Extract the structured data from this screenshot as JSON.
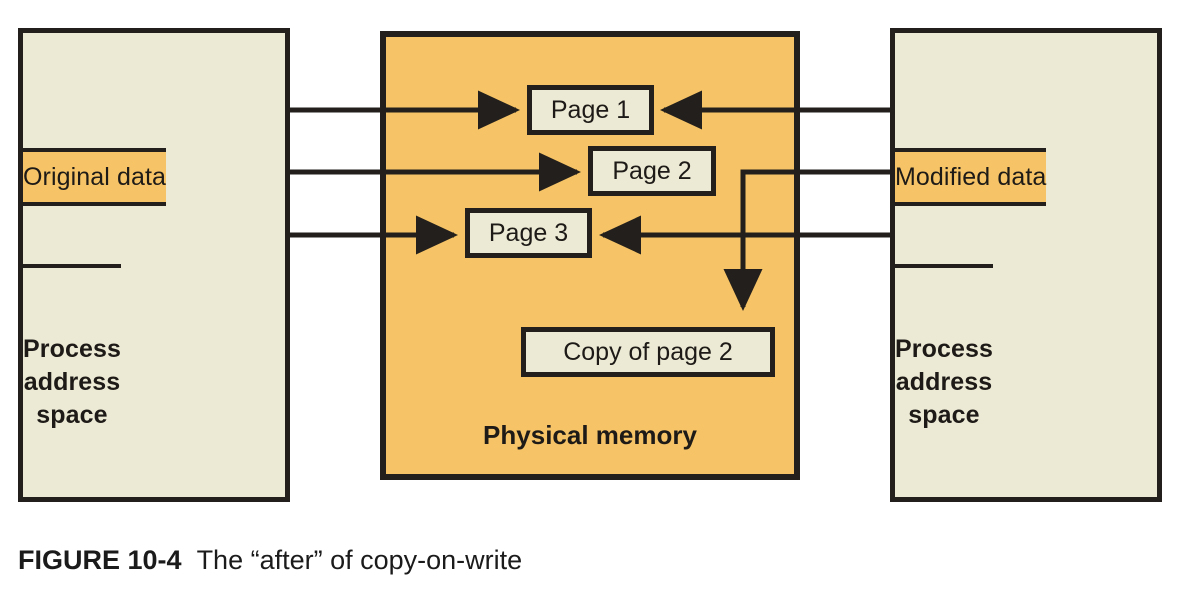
{
  "figure": {
    "number_label": "FIGURE 10-4",
    "caption": "The “after” of copy-on-write"
  },
  "colors": {
    "orange": "#F6C466",
    "cream": "#ECEAD4",
    "ink": "#231F1C",
    "background": "#FFFFFF"
  },
  "left_process": {
    "bands": [
      {
        "label": "",
        "fill": "cream"
      },
      {
        "label": "",
        "fill": "orange"
      },
      {
        "label": "Original data",
        "fill": "orange"
      },
      {
        "label": "",
        "fill": "orange"
      }
    ],
    "footer_label": "Process\naddress\nspace",
    "footer_line1": "Process",
    "footer_line2": "address",
    "footer_line3": "space"
  },
  "right_process": {
    "bands": [
      {
        "label": "",
        "fill": "cream"
      },
      {
        "label": "",
        "fill": "orange"
      },
      {
        "label": "Modified data",
        "fill": "orange"
      },
      {
        "label": "",
        "fill": "orange"
      }
    ],
    "footer_label": "Process\naddress\nspace",
    "footer_line1": "Process",
    "footer_line2": "address",
    "footer_line3": "space"
  },
  "physical_memory": {
    "label": "Physical memory",
    "pages": [
      {
        "label": "Page 1"
      },
      {
        "label": "Page 2"
      },
      {
        "label": "Page 3"
      },
      {
        "label": "Copy of page 2"
      }
    ]
  },
  "connectors": [
    {
      "name": "left-to-page1",
      "from": "left_process.band2",
      "to": "Page 1"
    },
    {
      "name": "left-to-page2",
      "from": "left_process.band3",
      "to": "Page 2"
    },
    {
      "name": "left-to-page3",
      "from": "left_process.band4",
      "to": "Page 3"
    },
    {
      "name": "right-to-page1",
      "from": "right_process.band2",
      "to": "Page 1"
    },
    {
      "name": "right-to-copy-of-page2",
      "from": "right_process.band3",
      "to": "Copy of page 2"
    },
    {
      "name": "right-to-page3",
      "from": "right_process.band4",
      "to": "Page 3"
    }
  ]
}
